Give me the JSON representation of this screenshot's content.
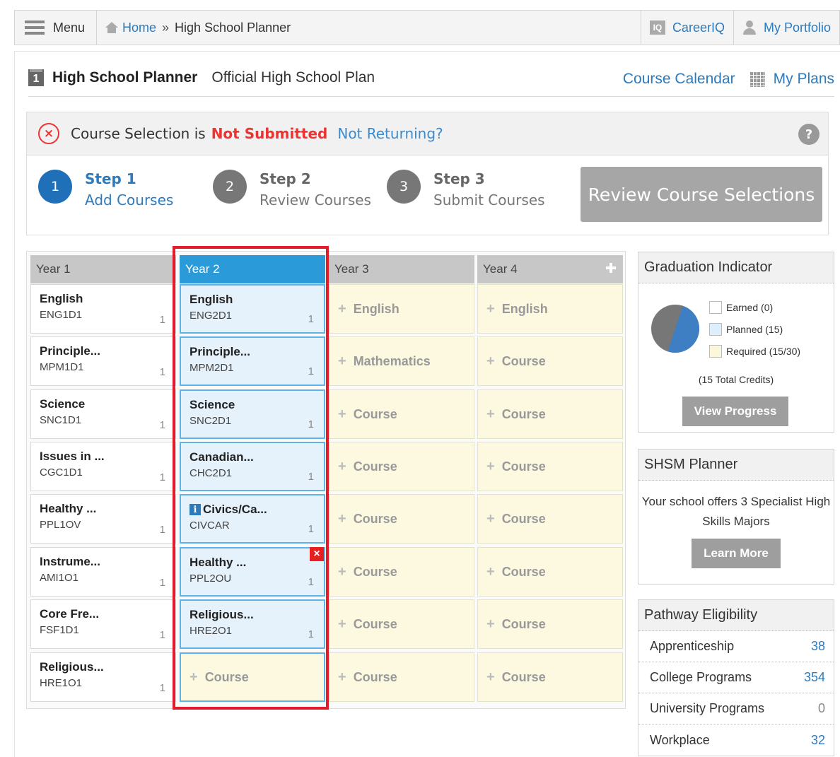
{
  "nav": {
    "menu_label": "Menu",
    "home_label": "Home",
    "separator": "»",
    "current_page": "High School Planner",
    "careeriq_icon_text": "IQ",
    "careeriq_label": "CareerIQ",
    "portfolio_label": "My Portfolio"
  },
  "title": {
    "icon_text": "1",
    "app_name": "High School Planner",
    "subtitle": "Official High School Plan",
    "course_calendar": "Course Calendar",
    "my_plans": "My Plans"
  },
  "status": {
    "prefix": "Course Selection is",
    "state": "Not Submitted",
    "not_returning": "Not Returning?",
    "help": "?",
    "icon_text": "×"
  },
  "steps": [
    {
      "num": "1",
      "title": "Step 1",
      "desc": "Add Courses"
    },
    {
      "num": "2",
      "title": "Step 2",
      "desc": "Review Courses"
    },
    {
      "num": "3",
      "title": "Step 3",
      "desc": "Submit Courses"
    }
  ],
  "review_button": "Review Course Selections",
  "planner": {
    "add_glyph": "+",
    "delete_glyph": "×",
    "info_glyph": "i",
    "years": [
      {
        "label": "Year 1",
        "cells": [
          {
            "name": "English",
            "code": "ENG1D1",
            "credits": "1"
          },
          {
            "name": "Principle...",
            "code": "MPM1D1",
            "credits": "1"
          },
          {
            "name": "Science",
            "code": "SNC1D1",
            "credits": "1"
          },
          {
            "name": "Issues in ...",
            "code": "CGC1D1",
            "credits": "1"
          },
          {
            "name": "Healthy ...",
            "code": "PPL1OV",
            "credits": "1"
          },
          {
            "name": "Instrume...",
            "code": "AMI1O1",
            "credits": "1"
          },
          {
            "name": "Core Fre...",
            "code": "FSF1D1",
            "credits": "1"
          },
          {
            "name": "Religious...",
            "code": "HRE1O1",
            "credits": "1"
          }
        ]
      },
      {
        "label": "Year 2",
        "cells": [
          {
            "name": "English",
            "code": "ENG2D1",
            "credits": "1"
          },
          {
            "name": "Principle...",
            "code": "MPM2D1",
            "credits": "1"
          },
          {
            "name": "Science",
            "code": "SNC2D1",
            "credits": "1"
          },
          {
            "name": "Canadian...",
            "code": "CHC2D1",
            "credits": "1"
          },
          {
            "name": "Civics/Ca...",
            "code": "CIVCAR",
            "credits": "1"
          },
          {
            "name": "Healthy ...",
            "code": "PPL2OU",
            "credits": "1"
          },
          {
            "name": "Religious...",
            "code": "HRE2O1",
            "credits": "1"
          },
          {
            "placeholder": "Course"
          }
        ]
      },
      {
        "label": "Year 3",
        "cells": [
          {
            "placeholder": "English"
          },
          {
            "placeholder": "Mathematics"
          },
          {
            "placeholder": "Course"
          },
          {
            "placeholder": "Course"
          },
          {
            "placeholder": "Course"
          },
          {
            "placeholder": "Course"
          },
          {
            "placeholder": "Course"
          },
          {
            "placeholder": "Course"
          }
        ]
      },
      {
        "label": "Year 4",
        "cells": [
          {
            "placeholder": "English"
          },
          {
            "placeholder": "Course"
          },
          {
            "placeholder": "Course"
          },
          {
            "placeholder": "Course"
          },
          {
            "placeholder": "Course"
          },
          {
            "placeholder": "Course"
          },
          {
            "placeholder": "Course"
          },
          {
            "placeholder": "Course"
          }
        ]
      }
    ]
  },
  "graduation": {
    "title": "Graduation Indicator",
    "legend": [
      {
        "label": "Earned (0)",
        "color": "#ffffff"
      },
      {
        "label": "Planned (15)",
        "color": "#dfeefb"
      },
      {
        "label": "Required (15/30)",
        "color": "#fbf6dc"
      }
    ],
    "pie": {
      "planned_fraction": 0.5,
      "planned_color": "#3e7ec2",
      "remaining_color": "#777777"
    },
    "total": "(15 Total Credits)",
    "button": "View Progress"
  },
  "shsm": {
    "title": "SHSM Planner",
    "text": "Your school offers 3 Specialist High Skills Majors",
    "button": "Learn More"
  },
  "pathway": {
    "title": "Pathway Eligibility",
    "rows": [
      {
        "label": "Apprenticeship",
        "value": "38"
      },
      {
        "label": "College Programs",
        "value": "354"
      },
      {
        "label": "University Programs",
        "value": "0"
      },
      {
        "label": "Workplace",
        "value": "32"
      }
    ]
  }
}
